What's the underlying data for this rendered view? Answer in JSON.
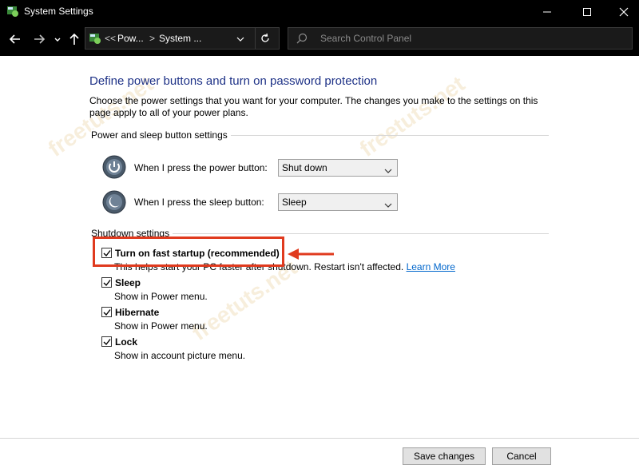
{
  "window": {
    "title": "System Settings"
  },
  "address_bar": {
    "breadcrumb_prefix": "<<",
    "crumb1": "Pow...",
    "crumb_sep": ">",
    "crumb2": "System ...",
    "search_placeholder": "Search Control Panel"
  },
  "page": {
    "title": "Define power buttons and turn on password protection",
    "description": "Choose the power settings that you want for your computer. The changes you make to the settings on this page apply to all of your power plans."
  },
  "power_sleep": {
    "group_label": "Power and sleep button settings",
    "power_button_label": "When I press the power button:",
    "power_button_value": "Shut down",
    "sleep_button_label": "When I press the sleep button:",
    "sleep_button_value": "Sleep"
  },
  "shutdown": {
    "group_label": "Shutdown settings",
    "items": [
      {
        "label": "Turn on fast startup (recommended)",
        "desc": "This helps start your PC faster after shutdown. Restart isn't affected.",
        "link": "Learn More",
        "checked": true
      },
      {
        "label": "Sleep",
        "desc": "Show in Power menu.",
        "checked": true
      },
      {
        "label": "Hibernate",
        "desc": "Show in Power menu.",
        "checked": true
      },
      {
        "label": "Lock",
        "desc": "Show in account picture menu.",
        "checked": true
      }
    ]
  },
  "footer": {
    "save_label": "Save changes",
    "cancel_label": "Cancel"
  },
  "watermarks": {
    "text": "freetuts.net"
  },
  "colors": {
    "title_blue": "#1e3287",
    "link_blue": "#0066cc",
    "highlight_red": "#e03a1e"
  }
}
